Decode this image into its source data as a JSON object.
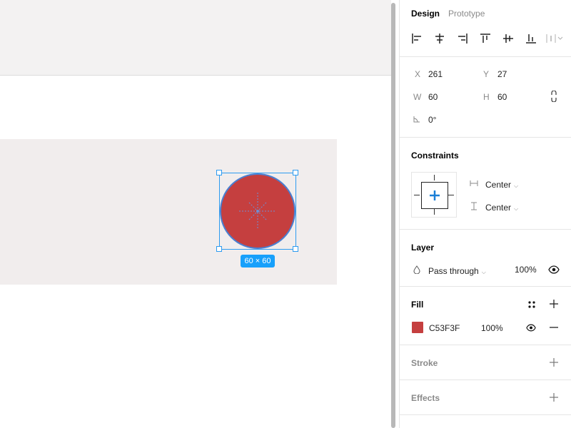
{
  "canvas": {
    "selection_size": "60 × 60",
    "shape_fill_color": "#C53F3F",
    "selection_color": "#18A0FB"
  },
  "tabs": {
    "design": "Design",
    "prototype": "Prototype"
  },
  "align_icons": [
    "align-left-icon",
    "align-horizontal-center-icon",
    "align-right-icon",
    "align-top-icon",
    "align-vertical-center-icon",
    "align-bottom-icon",
    "distribute-icon"
  ],
  "transform": {
    "x_label": "X",
    "x_value": "261",
    "y_label": "Y",
    "y_value": "27",
    "w_label": "W",
    "w_value": "60",
    "h_label": "H",
    "h_value": "60",
    "rotation_value": "0°"
  },
  "constraints": {
    "title": "Constraints",
    "horizontal": "Center",
    "vertical": "Center"
  },
  "layer": {
    "title": "Layer",
    "blend_mode": "Pass through",
    "opacity": "100%"
  },
  "fill": {
    "title": "Fill",
    "color_hex": "C53F3F",
    "swatch_color": "#C53F3F",
    "opacity": "100%"
  },
  "stroke": {
    "title": "Stroke"
  },
  "effects": {
    "title": "Effects"
  }
}
